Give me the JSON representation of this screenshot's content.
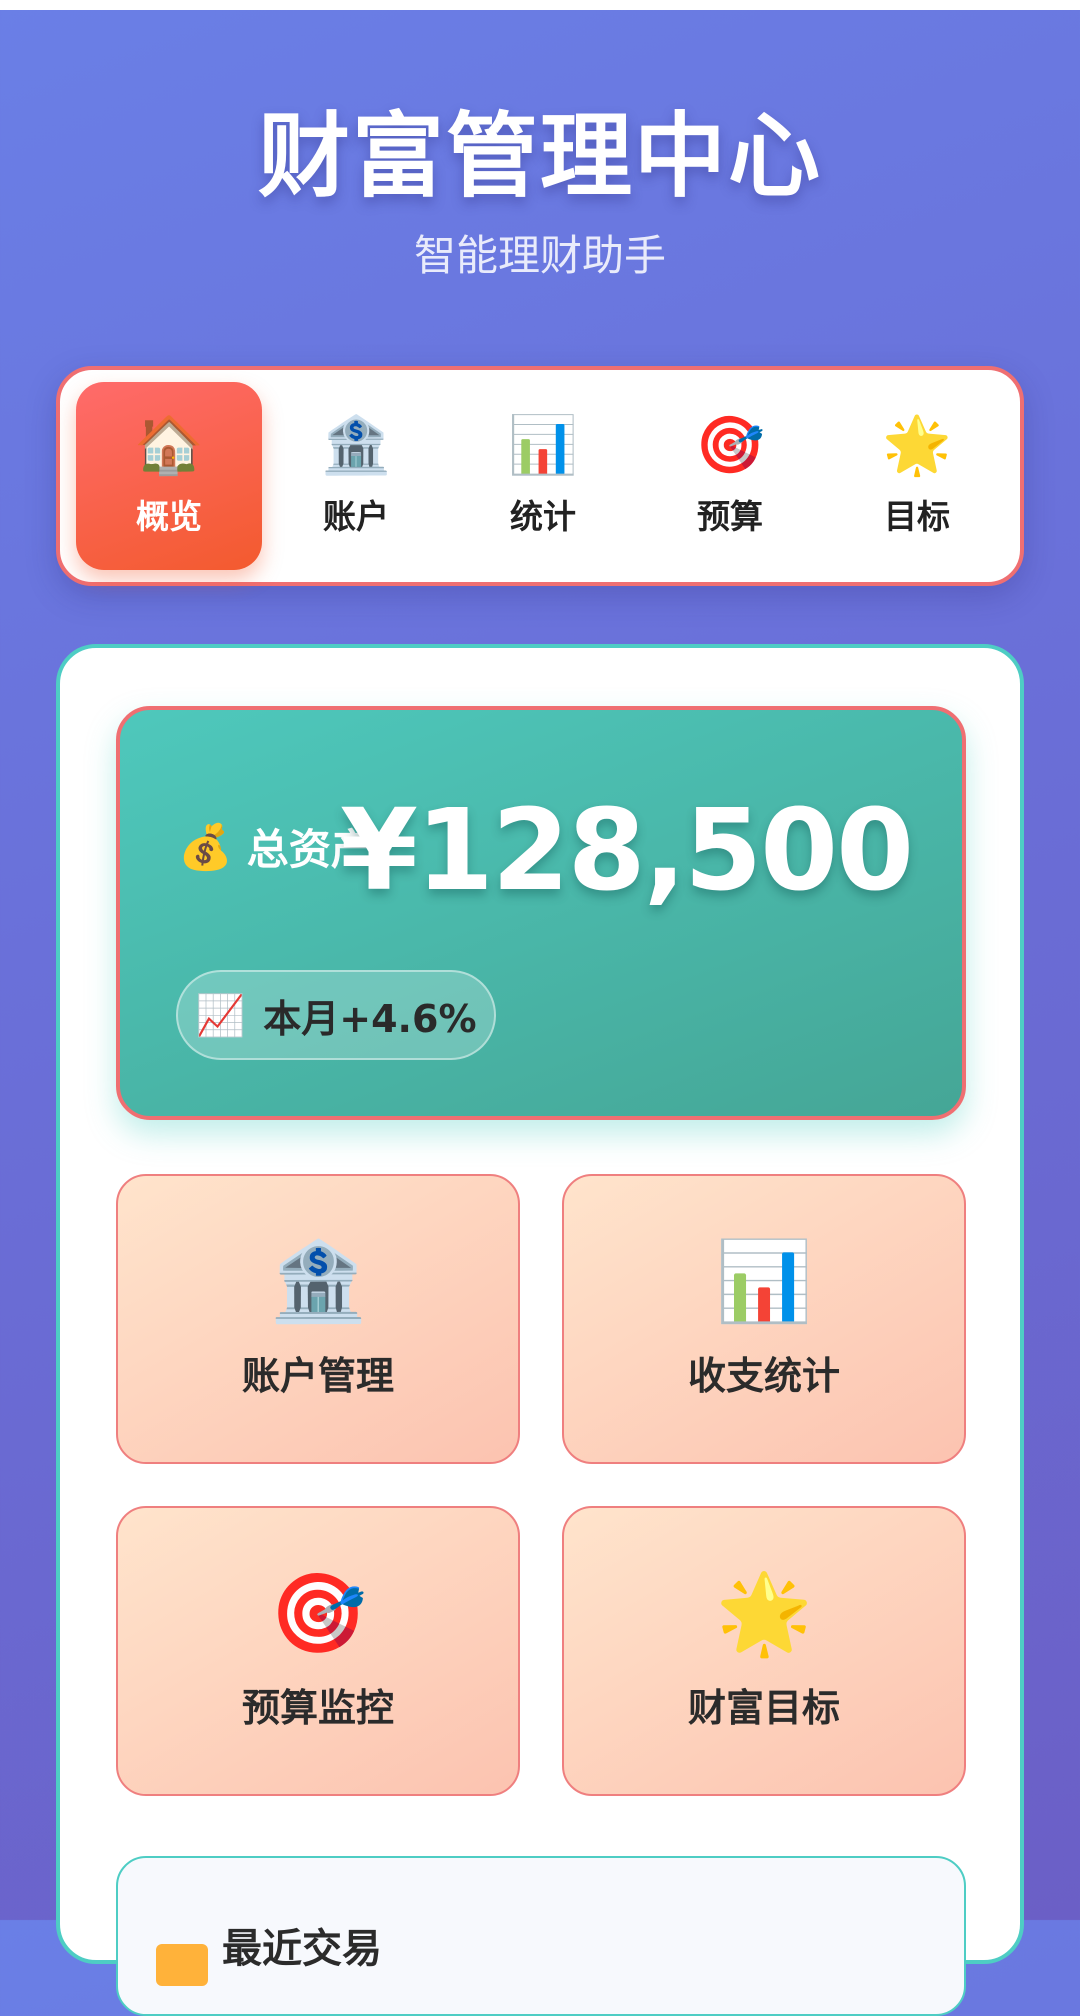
{
  "header": {
    "title": "财富管理中心",
    "subtitle": "智能理财助手"
  },
  "nav": {
    "items": [
      {
        "icon": "🏠",
        "label": "概览",
        "active": true
      },
      {
        "icon": "🏦",
        "label": "账户"
      },
      {
        "icon": "📊",
        "label": "统计"
      },
      {
        "icon": "🎯",
        "label": "预算"
      },
      {
        "icon": "🌟",
        "label": "目标"
      }
    ]
  },
  "summary": {
    "icon": "💰",
    "label": "总资产",
    "value": "¥128,500",
    "change_icon": "📈",
    "change_text": "本月+4.6%"
  },
  "tiles": [
    {
      "icon": "🏦",
      "label": "账户管理"
    },
    {
      "icon": "📊",
      "label": "收支统计"
    },
    {
      "icon": "🎯",
      "label": "预算监控"
    },
    {
      "icon": "🌟",
      "label": "财富目标"
    }
  ],
  "recent": {
    "title": "最近交易"
  },
  "colors": {
    "background": "#6a75e0",
    "accent_red": "#ef6f72",
    "accent_teal": "#4ecdc4",
    "active_tab": "#f35a2e"
  }
}
